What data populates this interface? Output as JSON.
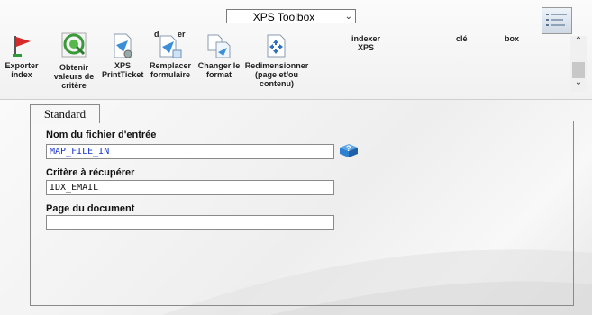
{
  "toolbox": {
    "selected": "XPS Toolbox"
  },
  "buttons": [
    {
      "id": "export",
      "label_lines": [
        "Exporter",
        "index"
      ],
      "icon": "red-flag-icon"
    },
    {
      "id": "obtain",
      "label_lines": [
        "Obtenir",
        "valeurs de",
        "critère"
      ],
      "icon": "green-target-icon"
    },
    {
      "id": "printticket",
      "label_lines": [
        "XPS",
        "PrintTicket"
      ],
      "icon": "xps-printticket-icon"
    },
    {
      "id": "replace",
      "label_lines": [
        "Remplacer",
        "formulaire"
      ],
      "icon": "replace-form-icon"
    },
    {
      "id": "changeformat",
      "label_lines": [
        "Changer le",
        "format"
      ],
      "icon": "change-format-icon"
    },
    {
      "id": "resize",
      "label_lines": [
        "Redimensionner",
        "(page et/ou",
        "contenu)"
      ],
      "icon": "resize-icon"
    }
  ],
  "ghost_labels": {
    "first": "d",
    "first_tail": "er",
    "indexer_lines": [
      "indexer",
      "XPS"
    ],
    "cle": "clé",
    "box": "box"
  },
  "tab": {
    "label": "Standard"
  },
  "fields": [
    {
      "label": "Nom du fichier d'entrée",
      "value": "MAP_FILE_IN",
      "color": "#1a36c8"
    },
    {
      "label": "Critère à récupérer",
      "value": "IDX_EMAIL",
      "color": "#111111"
    },
    {
      "label": "Page du document",
      "value": ""
    }
  ],
  "colors": {
    "field_blue": "#1a36c8",
    "help_icon": "#2d7fd0"
  }
}
